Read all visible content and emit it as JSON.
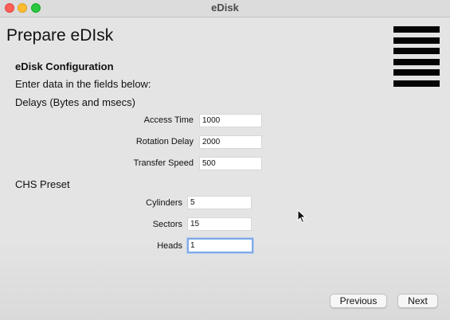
{
  "window": {
    "title": "eDisk"
  },
  "page": {
    "title": "Prepare eDIsk",
    "menu_icon": "hamburger-menu-icon"
  },
  "config": {
    "heading": "eDisk Configuration",
    "instructions": "Enter data in the fields below:",
    "delays": {
      "heading": "Delays (Bytes and msecs)",
      "fields": [
        {
          "label": "Access Time",
          "value": "1000"
        },
        {
          "label": "Rotation Delay",
          "value": "2000"
        },
        {
          "label": "Transfer Speed",
          "value": "500"
        }
      ]
    },
    "chs": {
      "heading": "CHS Preset",
      "fields": [
        {
          "label": "Cylinders",
          "value": "5"
        },
        {
          "label": "Sectors",
          "value": "15"
        },
        {
          "label": "Heads",
          "value": "1"
        }
      ]
    }
  },
  "buttons": {
    "previous": "Previous",
    "next": "Next"
  },
  "colors": {
    "close": "#fe5f57",
    "minimize": "#febc2e",
    "maximize": "#28c840",
    "focus_ring": "#7fa9e6"
  }
}
